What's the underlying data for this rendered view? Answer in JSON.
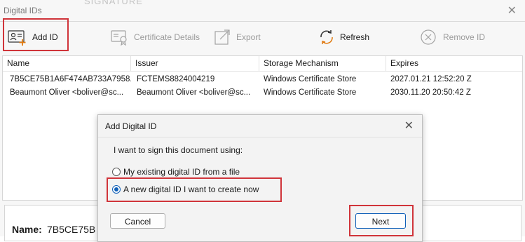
{
  "window": {
    "title": "Digital IDs",
    "ghost_title": "SIGNATURE"
  },
  "toolbar": {
    "add_id": "Add ID",
    "certificate_details": "Certificate Details",
    "export": "Export",
    "refresh": "Refresh",
    "remove_id": "Remove ID"
  },
  "table": {
    "columns": [
      "Name",
      "Issuer",
      "Storage Mechanism",
      "Expires"
    ],
    "rows": [
      [
        "7B5CE75B1A6F474AB733A7958...",
        "FCTEMS8824004219",
        "Windows Certificate Store",
        "2027.01.21 12:52:20 Z"
      ],
      [
        "Beaumont Oliver <boliver@sc...",
        "Beaumont Oliver <boliver@sc...",
        "Windows Certificate Store",
        "2030.11.20 20:50:42 Z"
      ]
    ]
  },
  "detail": {
    "name_label": "Name:",
    "name_value": "7B5CE75B"
  },
  "dialog": {
    "title": "Add Digital ID",
    "prompt": "I want to sign this document using:",
    "options": [
      {
        "label": "My existing digital ID from a file",
        "selected": false
      },
      {
        "label": "A new digital ID I want to create now",
        "selected": true
      }
    ],
    "cancel": "Cancel",
    "next": "Next"
  },
  "colors": {
    "highlight": "#d0343a",
    "accent": "#0f5fb8",
    "refresh_icon_orange": "#e07a10"
  }
}
